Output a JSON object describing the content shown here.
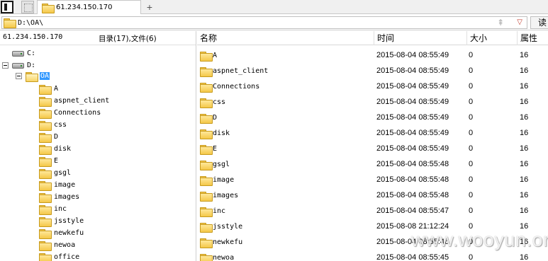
{
  "tabs": [
    {
      "label": "61.234.150.170"
    }
  ],
  "path": {
    "value": "D:\\OA\\",
    "read_label": "读"
  },
  "left": {
    "host": "61.234.150.170",
    "summary": "目录(17),文件(6)",
    "drives": [
      {
        "label": "C:"
      },
      {
        "label": "D:"
      }
    ],
    "current_folder": "OA",
    "subfolders": [
      "A",
      "aspnet_client",
      "Connections",
      "css",
      "D",
      "disk",
      "E",
      "gsgl",
      "image",
      "images",
      "inc",
      "jsstyle",
      "newkefu",
      "newoa",
      "office"
    ]
  },
  "columns": {
    "name": "名称",
    "time": "时间",
    "size": "大小",
    "attr": "属性"
  },
  "files": [
    {
      "name": "A",
      "time": "2015-08-04 08:55:49",
      "size": "0",
      "attr": "16"
    },
    {
      "name": "aspnet_client",
      "time": "2015-08-04 08:55:49",
      "size": "0",
      "attr": "16"
    },
    {
      "name": "Connections",
      "time": "2015-08-04 08:55:49",
      "size": "0",
      "attr": "16"
    },
    {
      "name": "css",
      "time": "2015-08-04 08:55:49",
      "size": "0",
      "attr": "16"
    },
    {
      "name": "D",
      "time": "2015-08-04 08:55:49",
      "size": "0",
      "attr": "16"
    },
    {
      "name": "disk",
      "time": "2015-08-04 08:55:49",
      "size": "0",
      "attr": "16"
    },
    {
      "name": "E",
      "time": "2015-08-04 08:55:49",
      "size": "0",
      "attr": "16"
    },
    {
      "name": "gsgl",
      "time": "2015-08-04 08:55:48",
      "size": "0",
      "attr": "16"
    },
    {
      "name": "image",
      "time": "2015-08-04 08:55:48",
      "size": "0",
      "attr": "16"
    },
    {
      "name": "images",
      "time": "2015-08-04 08:55:48",
      "size": "0",
      "attr": "16"
    },
    {
      "name": "inc",
      "time": "2015-08-04 08:55:47",
      "size": "0",
      "attr": "16"
    },
    {
      "name": "jsstyle",
      "time": "2015-08-08 21:12:24",
      "size": "0",
      "attr": "16"
    },
    {
      "name": "newkefu",
      "time": "2015-08-04 08:55:46",
      "size": "0",
      "attr": "16"
    },
    {
      "name": "newoa",
      "time": "2015-08-04 08:55:45",
      "size": "0",
      "attr": "16"
    }
  ],
  "watermark": "www.wooyun.org"
}
